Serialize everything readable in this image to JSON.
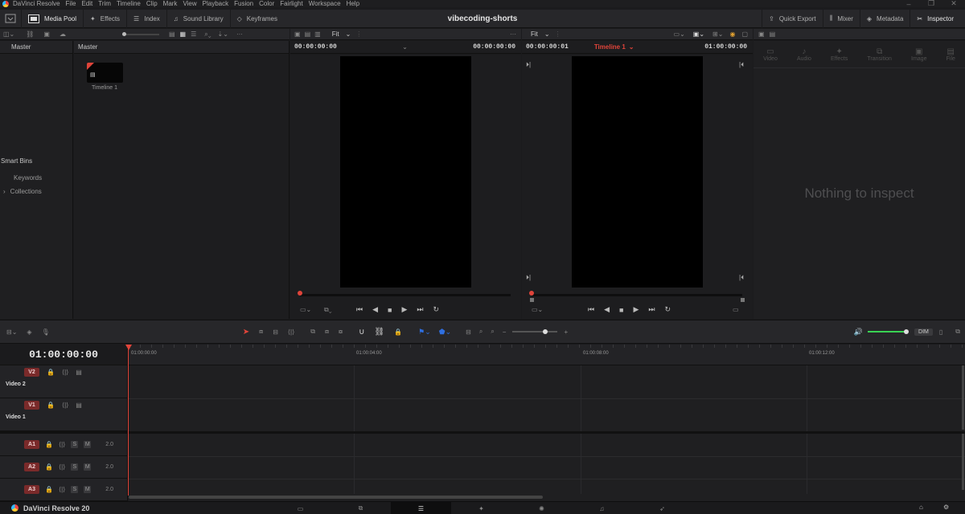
{
  "menubar": {
    "app_name": "DaVinci Resolve",
    "items": [
      "File",
      "Edit",
      "Trim",
      "Timeline",
      "Clip",
      "Mark",
      "View",
      "Playback",
      "Fusion",
      "Color",
      "Fairlight",
      "Workspace",
      "Help"
    ]
  },
  "toolbar": {
    "media_pool": "Media Pool",
    "effects": "Effects",
    "index": "Index",
    "sound_library": "Sound Library",
    "keyframes": "Keyframes",
    "project_title": "vibecoding-shorts",
    "quick_export": "Quick Export",
    "mixer": "Mixer",
    "metadata": "Metadata",
    "inspector": "Inspector"
  },
  "media_pool": {
    "bin_header": "Master",
    "content_header": "Master",
    "tree_root": "Master",
    "smart_bins": "Smart Bins",
    "keywords": "Keywords",
    "collections": "Collections",
    "clip_name": "Timeline 1"
  },
  "source_viewer": {
    "zoom": "Fit",
    "timecode_left": "00:00:00:00",
    "timecode_right": "00:00:00:00"
  },
  "timeline_viewer": {
    "zoom": "Fit",
    "timecode_left": "00:00:00:01",
    "timeline_name": "Timeline 1",
    "timecode_right": "01:00:00:00"
  },
  "inspector": {
    "tabs": [
      "Video",
      "Audio",
      "Effects",
      "Transition",
      "Image",
      "File"
    ],
    "empty_message": "Nothing to inspect"
  },
  "timeline": {
    "current_timecode": "01:00:00:00",
    "dim_label": "DIM",
    "ruler": [
      "01:00:00:00",
      "01:00:04:00",
      "01:00:08:00",
      "01:00:12:00"
    ],
    "video_tracks": [
      {
        "badge": "V2",
        "name": "Video 2"
      },
      {
        "badge": "V1",
        "name": "Video 1"
      }
    ],
    "audio_tracks": [
      {
        "badge": "A1",
        "s": "S",
        "m": "M",
        "level": "2.0"
      },
      {
        "badge": "A2",
        "s": "S",
        "m": "M",
        "level": "2.0"
      },
      {
        "badge": "A3",
        "s": "S",
        "m": "M",
        "level": "2.0"
      }
    ]
  },
  "bottombar": {
    "version": "DaVinci Resolve 20"
  },
  "colors": {
    "accent_red": "#e0443a",
    "track_red": "#7a2a2a",
    "blue_marker": "#2f6fe0",
    "volume_green": "#39d353"
  }
}
